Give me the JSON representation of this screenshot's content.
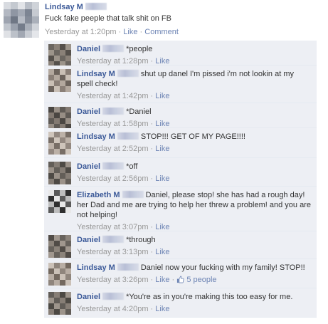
{
  "status": {
    "author": "Lindsay M",
    "message": "Fuck fake peeple that talk shit on FB",
    "time": "Yesterday at 1:20pm",
    "like_label": "Like",
    "comment_label": "Comment"
  },
  "comments": [
    {
      "author": "Daniel",
      "text": "*people",
      "time": "Yesterday at 1:28pm",
      "like_label": "Like"
    },
    {
      "author": "Lindsay M",
      "text": "shut up danel I'm pissed i'm not lookin at my spell check!",
      "time": "Yesterday at 1:42pm",
      "like_label": "Like"
    },
    {
      "author": "Daniel",
      "text": "*Daniel",
      "time": "Yesterday at 1:58pm",
      "like_label": "Like"
    },
    {
      "author": "Lindsay M",
      "text": "STOP!!! GET OF MY PAGE!!!!",
      "time": "Yesterday at 2:52pm",
      "like_label": "Like"
    },
    {
      "author": "Daniel",
      "text": "*off",
      "time": "Yesterday at 2:56pm",
      "like_label": "Like"
    },
    {
      "author": "Elizabeth M",
      "text": "Daniel, please stop! she has had a rough day! her Dad and me are trying to help her threw a problem! and you are not helping!",
      "time": "Yesterday at 3:07pm",
      "like_label": "Like"
    },
    {
      "author": "Daniel",
      "text": "*through",
      "time": "Yesterday at 3:13pm",
      "like_label": "Like"
    },
    {
      "author": "Lindsay M",
      "text": "Daniel now your fucking with my family! STOP!!",
      "time": "Yesterday at 3:26pm",
      "like_label": "Like",
      "likes": "5 people"
    },
    {
      "author": "Daniel",
      "text": "*You're as in you're making this too easy for me.",
      "time": "Yesterday at 4:20pm",
      "like_label": "Like"
    }
  ],
  "colors": {
    "name_blue": "#3b5998",
    "link_blue": "#6d84b4",
    "comment_bg": "#edeff4",
    "meta_gray": "#999999"
  }
}
